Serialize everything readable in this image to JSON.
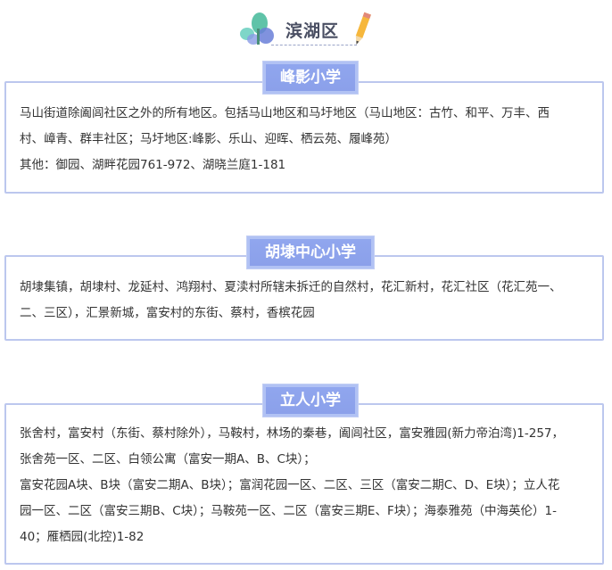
{
  "header": {
    "title": "滨湖区"
  },
  "sections": [
    {
      "label": "峰影小学",
      "lines": [
        "马山街道除阖闾社区之外的所有地区。包括马山地区和马圩地区（马山地区：古竹、和平、万丰、西",
        "村、嶂青、群丰社区；马圩地区:峰影、乐山、迎晖、栖云苑、履峰苑）",
        "其他：御园、湖畔花园761-972、湖晓兰庭1-181"
      ]
    },
    {
      "label": "胡埭中心小学",
      "lines": [
        "胡埭集镇，胡埭村、龙延村、鸿翔村、夏渎村所辖未拆迁的自然村，花汇新村，花汇社区（花汇苑一、",
        "二、三区），汇景新城，富安村的东街、蔡村，香槟花园"
      ]
    },
    {
      "label": "立人小学",
      "lines": [
        "张舍村，富安村（东街、蔡村除外），马鞍村，林场的秦巷，阖闾社区，富安雅园(新力帝泊湾)1-257，",
        "张舍苑一区、二区、白领公寓（富安一期A、B、C块）；",
        "富安花园A块、B块（富安二期A、B块）；富润花园一区、二区、三区（富安二期C、D、E块）；立人花",
        "园一区、二区（富安三期B、C块）；马鞍苑一区、二区（富安三期E、F块）；海泰雅苑（中海英伦）1-",
        "40；雁栖园(北控)1-82"
      ]
    }
  ]
}
